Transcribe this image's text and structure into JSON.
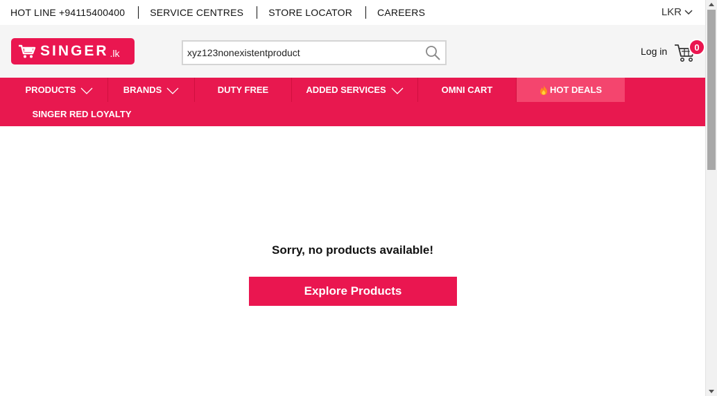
{
  "topbar": {
    "links": [
      "HOT LINE +94115400400",
      "SERVICE CENTRES",
      "STORE LOCATOR",
      "CAREERS"
    ],
    "currency": "LKR"
  },
  "header": {
    "logo": {
      "brand": "SINGER",
      "tld": ".lk"
    },
    "search": {
      "value": "xyz123nonexistentproduct",
      "icon": "search-icon"
    },
    "login_label": "Log in",
    "cart_count": "0"
  },
  "nav": {
    "row1": [
      {
        "label": "PRODUCTS",
        "has_dropdown": true
      },
      {
        "label": "BRANDS",
        "has_dropdown": true
      },
      {
        "label": "DUTY FREE",
        "has_dropdown": false
      },
      {
        "label": "ADDED SERVICES",
        "has_dropdown": true
      },
      {
        "label": "OMNI CART",
        "has_dropdown": false
      },
      {
        "label": "HOT DEALS",
        "has_dropdown": false,
        "icon": "flame-icon",
        "highlighted": true
      }
    ],
    "row2": [
      {
        "label": "SINGER RED LOYALTY",
        "has_dropdown": false
      }
    ]
  },
  "main": {
    "empty_message": "Sorry, no products available!",
    "explore_button": "Explore Products"
  },
  "colors": {
    "brand": "#ea1650",
    "nav_bg": "#e8184f",
    "hot_deals_bg": "#f4456e",
    "header_bg": "#f5f5f5"
  }
}
